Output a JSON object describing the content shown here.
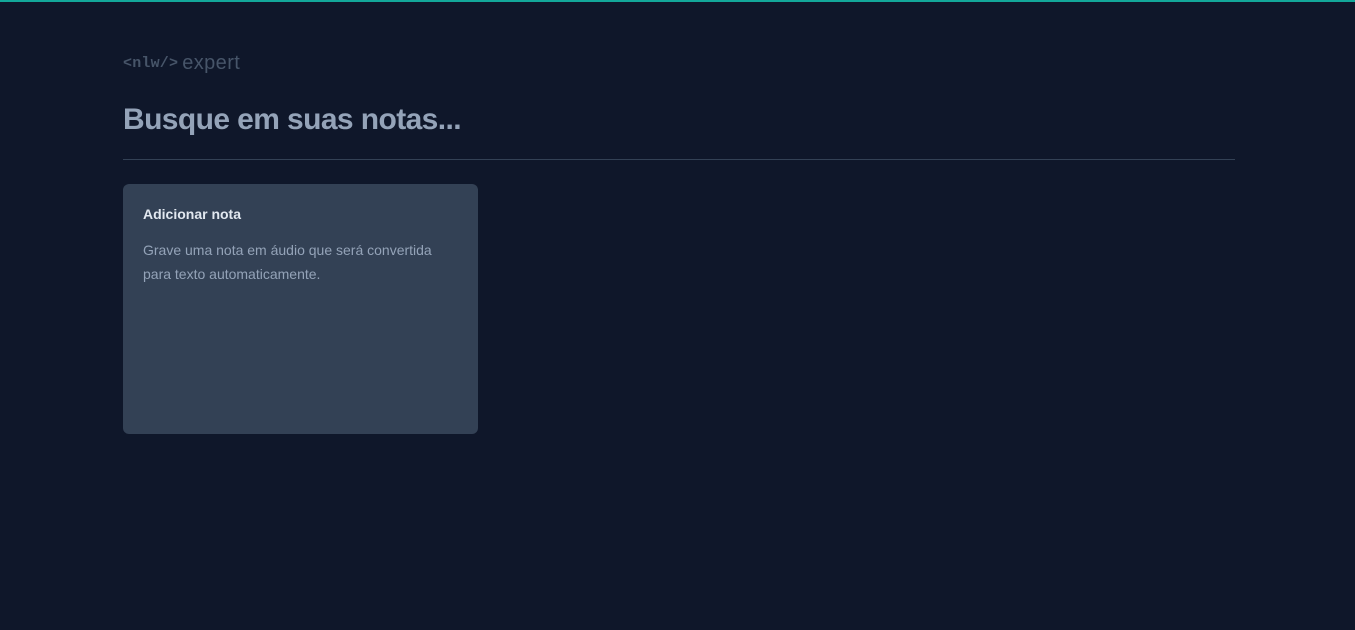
{
  "logo": {
    "code_part": "<nlw/>",
    "word_part": "expert"
  },
  "search": {
    "placeholder": "Busque em suas notas...",
    "value": ""
  },
  "notes": {
    "add_card": {
      "title": "Adicionar nota",
      "description": "Grave uma nota em áudio que será convertida para texto automaticamente."
    }
  },
  "colors": {
    "background": "#0f172a",
    "accent": "#14b8a6",
    "card": "#334155",
    "divider": "#334155"
  }
}
